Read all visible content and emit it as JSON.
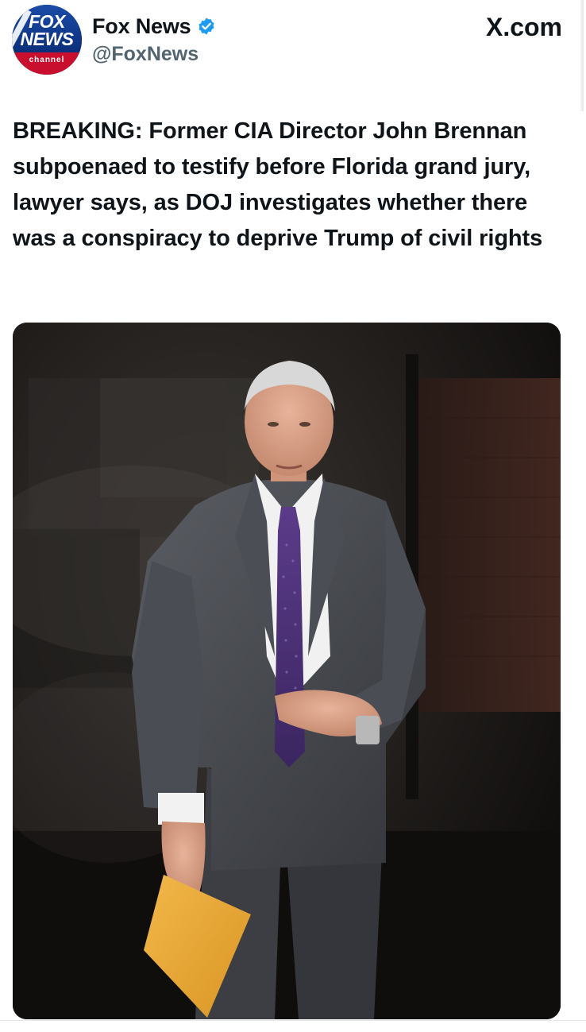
{
  "post": {
    "avatar": {
      "line1": "FOX",
      "line2": "NEWS",
      "line3": "channel"
    },
    "account_name": "Fox News",
    "handle": "@FoxNews",
    "site_label": "X.com",
    "headline": "BREAKING: Former CIA Director John Brennan subpoenaed to testify before Florida grand jury, lawyer says, as DOJ investigates whether there was a conspiracy to deprive Trump of civil rights"
  },
  "colors": {
    "verified": "#1d9bf0",
    "text_primary": "#0f1419",
    "text_secondary": "#536471",
    "fox_blue": "#0b2f7a",
    "fox_red": "#c8102e"
  },
  "icons": {
    "verified": "verified-badge-icon"
  }
}
